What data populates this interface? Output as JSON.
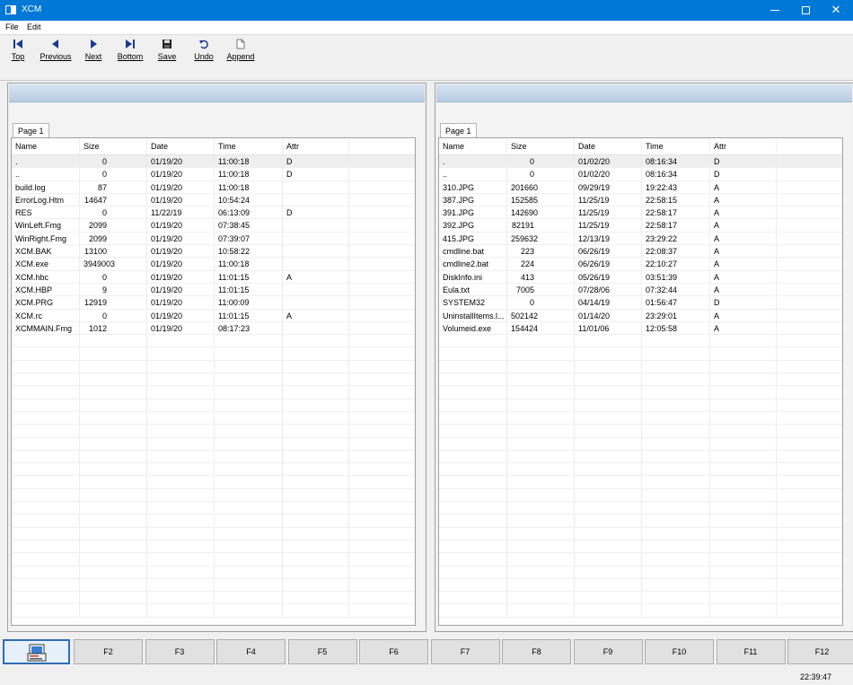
{
  "window": {
    "title": "XCM"
  },
  "menu": [
    "File",
    "Edit"
  ],
  "toolbar": [
    {
      "id": "top",
      "label": "Top",
      "icon": "first-record-icon"
    },
    {
      "id": "previous",
      "label": "Previous",
      "icon": "previous-record-icon"
    },
    {
      "id": "next",
      "label": "Next",
      "icon": "next-record-icon"
    },
    {
      "id": "bottom",
      "label": "Bottom",
      "icon": "last-record-icon"
    },
    {
      "id": "save",
      "label": "Save",
      "icon": "floppy-disk-icon"
    },
    {
      "id": "undo",
      "label": "Undo",
      "icon": "undo-icon"
    },
    {
      "id": "append",
      "label": "Append",
      "icon": "new-document-icon"
    }
  ],
  "columns": [
    "Name",
    "Size",
    "Date",
    "Time",
    "Attr"
  ],
  "left_panel": {
    "tab": "Page 1",
    "rows": [
      [
        ".",
        "0",
        "01/19/20",
        "11:00:18",
        "D"
      ],
      [
        "..",
        "0",
        "01/19/20",
        "11:00:18",
        "D"
      ],
      [
        "build.log",
        "87",
        "01/19/20",
        "11:00:18",
        ""
      ],
      [
        "ErrorLog.Htm",
        "14647",
        "01/19/20",
        "10:54:24",
        ""
      ],
      [
        "RES",
        "0",
        "11/22/19",
        "06:13:09",
        "D"
      ],
      [
        "WinLeft.Fmg",
        "2099",
        "01/19/20",
        "07:38:45",
        ""
      ],
      [
        "WinRight.Fmg",
        "2099",
        "01/19/20",
        "07:39:07",
        ""
      ],
      [
        "XCM.BAK",
        "13100",
        "01/19/20",
        "10:58:22",
        ""
      ],
      [
        "XCM.exe",
        "3949003",
        "01/19/20",
        "11:00:18",
        ""
      ],
      [
        "XCM.hbc",
        "0",
        "01/19/20",
        "11:01:15",
        "A"
      ],
      [
        "XCM.HBP",
        "9",
        "01/19/20",
        "11:01:15",
        ""
      ],
      [
        "XCM.PRG",
        "12919",
        "01/19/20",
        "11:00:09",
        ""
      ],
      [
        "XCM.rc",
        "0",
        "01/19/20",
        "11:01:15",
        "A"
      ],
      [
        "XCMMAIN.Fmg",
        "1012",
        "01/19/20",
        "08:17:23",
        ""
      ]
    ]
  },
  "right_panel": {
    "tab": "Page 1",
    "rows": [
      [
        ".",
        "0",
        "01/02/20",
        "08:16:34",
        "D"
      ],
      [
        "..",
        "0",
        "01/02/20",
        "08:16:34",
        "D"
      ],
      [
        "310.JPG",
        "201660",
        "09/29/19",
        "19:22:43",
        "A"
      ],
      [
        "387.JPG",
        "152585",
        "11/25/19",
        "22:58:15",
        "A"
      ],
      [
        "391.JPG",
        "142690",
        "11/25/19",
        "22:58:17",
        "A"
      ],
      [
        "392.JPG",
        "82191",
        "11/25/19",
        "22:58:17",
        "A"
      ],
      [
        "415.JPG",
        "259632",
        "12/13/19",
        "23:29:22",
        "A"
      ],
      [
        "cmdline.bat",
        "223",
        "06/26/19",
        "22:08:37",
        "A"
      ],
      [
        "cmdline2.bat",
        "224",
        "06/26/19",
        "22:10:27",
        "A"
      ],
      [
        "DiskInfo.ini",
        "413",
        "05/26/19",
        "03:51:39",
        "A"
      ],
      [
        "Eula.txt",
        "7005",
        "07/28/06",
        "07:32:44",
        "A"
      ],
      [
        "SYSTEM32",
        "0",
        "04/14/19",
        "01:56:47",
        "D"
      ],
      [
        "UninstallItems.l...",
        "502142",
        "01/14/20",
        "23:29:01",
        "A"
      ],
      [
        "Volumeid.exe",
        "154424",
        "11/01/06",
        "12:05:58",
        "A"
      ]
    ]
  },
  "fkeys": [
    "F2",
    "F3",
    "F4",
    "F5",
    "F6",
    "F7",
    "F8",
    "F9",
    "F10",
    "F11",
    "F12"
  ],
  "status": {
    "clock": "22:39:47"
  },
  "colors": {
    "titlebar": "#0078d7",
    "panel_header": "#c9d9ec",
    "selected_row": "#efefef"
  }
}
